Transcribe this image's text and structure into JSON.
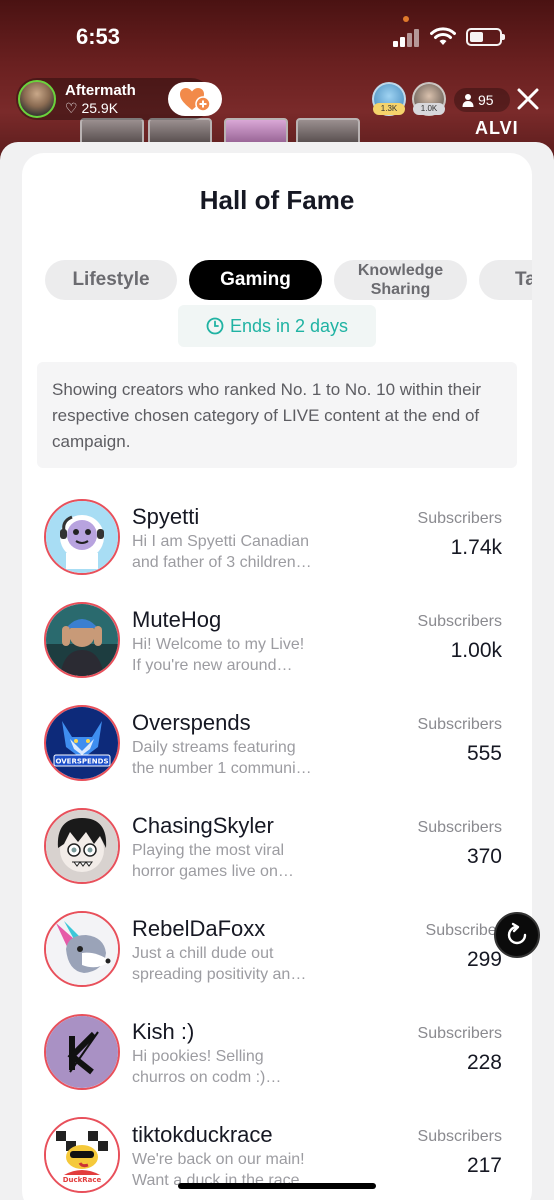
{
  "status_bar": {
    "time": "6:53",
    "battery_level": 0.45
  },
  "live": {
    "host_name": "Aftermath",
    "host_likes": "♡ 25.9K",
    "viewer_badges": [
      "1.3K",
      "1.0K"
    ],
    "viewer_count": "95",
    "overlay_text": "ALVI"
  },
  "sheet": {
    "title": "Hall of Fame",
    "tabs": [
      {
        "label": "Lifestyle",
        "active": false
      },
      {
        "label": "Gaming",
        "active": true
      },
      {
        "label": "Knowledge Sharing",
        "active": false
      },
      {
        "label": "Ta",
        "active": false
      }
    ],
    "countdown": "Ends in 2 days",
    "notice": "Showing creators who ranked No. 1 to No. 10 within their respective chosen category of LIVE content at the end of campaign."
  },
  "creators": [
    {
      "name": "Spyetti",
      "bio_1": "Hi I am Spyetti Canadian",
      "bio_2": "and father of 3 children…",
      "label": "Subscribers",
      "value": "1.74k"
    },
    {
      "name": "MuteHog",
      "bio_1": "Hi! Welcome to my Live!",
      "bio_2": "If you're new around…",
      "label": "Subscribers",
      "value": "1.00k"
    },
    {
      "name": "Overspends",
      "bio_1": "Daily streams featuring",
      "bio_2": "the number 1 communi…",
      "label": "Subscribers",
      "value": "555"
    },
    {
      "name": "ChasingSkyler",
      "bio_1": "Playing the most viral",
      "bio_2": "horror games live on…",
      "label": "Subscribers",
      "value": "370"
    },
    {
      "name": "RebelDaFoxx",
      "bio_1": "Just a chill dude out",
      "bio_2": "spreading positivity an…",
      "label": "Subscriber",
      "value": "299"
    },
    {
      "name": "Kish :)",
      "bio_1": "Hi pookies! Selling",
      "bio_2": "churros on codm :)…",
      "label": "Subscribers",
      "value": "228"
    },
    {
      "name": "tiktokduckrace",
      "bio_1": "We're back on our main!",
      "bio_2": "Want a duck in the race",
      "label": "Subscribers",
      "value": "217"
    }
  ],
  "avatar_art": {
    "overspends_logo": "OVERSPENDS",
    "duckrace_logo": "DuckRace"
  },
  "colors": {
    "accent_teal": "#20b3a3",
    "avatar_ring": "#e8505b",
    "active_tab": "#000000"
  }
}
